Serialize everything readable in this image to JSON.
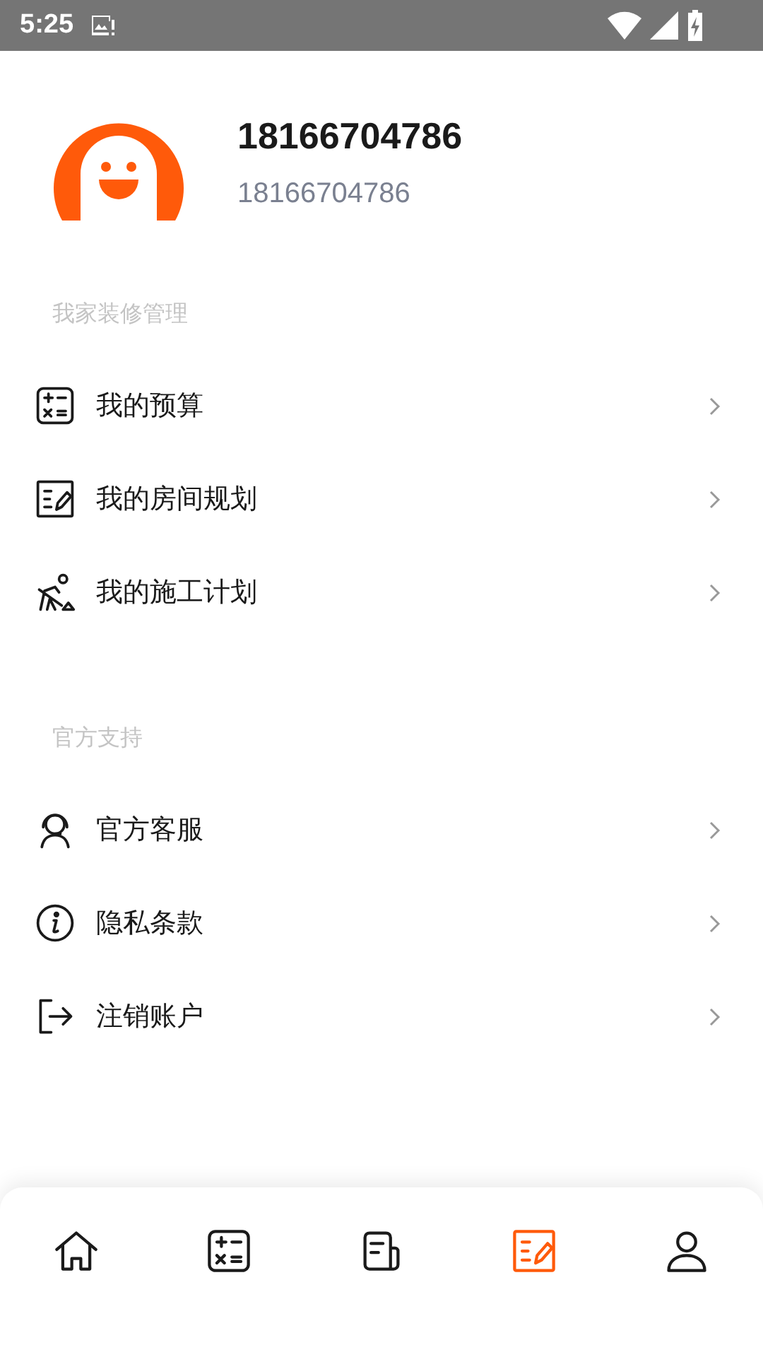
{
  "status_bar": {
    "time": "5:25"
  },
  "profile": {
    "name": "18166704786",
    "account": "18166704786"
  },
  "sections": [
    {
      "title": "我家装修管理",
      "items": [
        {
          "kind": "calculator",
          "label": "我的预算"
        },
        {
          "kind": "plan",
          "label": "我的房间规划"
        },
        {
          "kind": "worker",
          "label": "我的施工计划"
        }
      ]
    },
    {
      "title": "官方支持",
      "items": [
        {
          "kind": "service",
          "label": "官方客服"
        },
        {
          "kind": "info",
          "label": "隐私条款"
        },
        {
          "kind": "logout",
          "label": "注销账户"
        }
      ]
    }
  ],
  "bottom_nav": [
    {
      "kind": "home",
      "selected": false
    },
    {
      "kind": "calculator",
      "selected": false
    },
    {
      "kind": "news",
      "selected": false
    },
    {
      "kind": "plan",
      "selected": true
    },
    {
      "kind": "person",
      "selected": false
    }
  ]
}
